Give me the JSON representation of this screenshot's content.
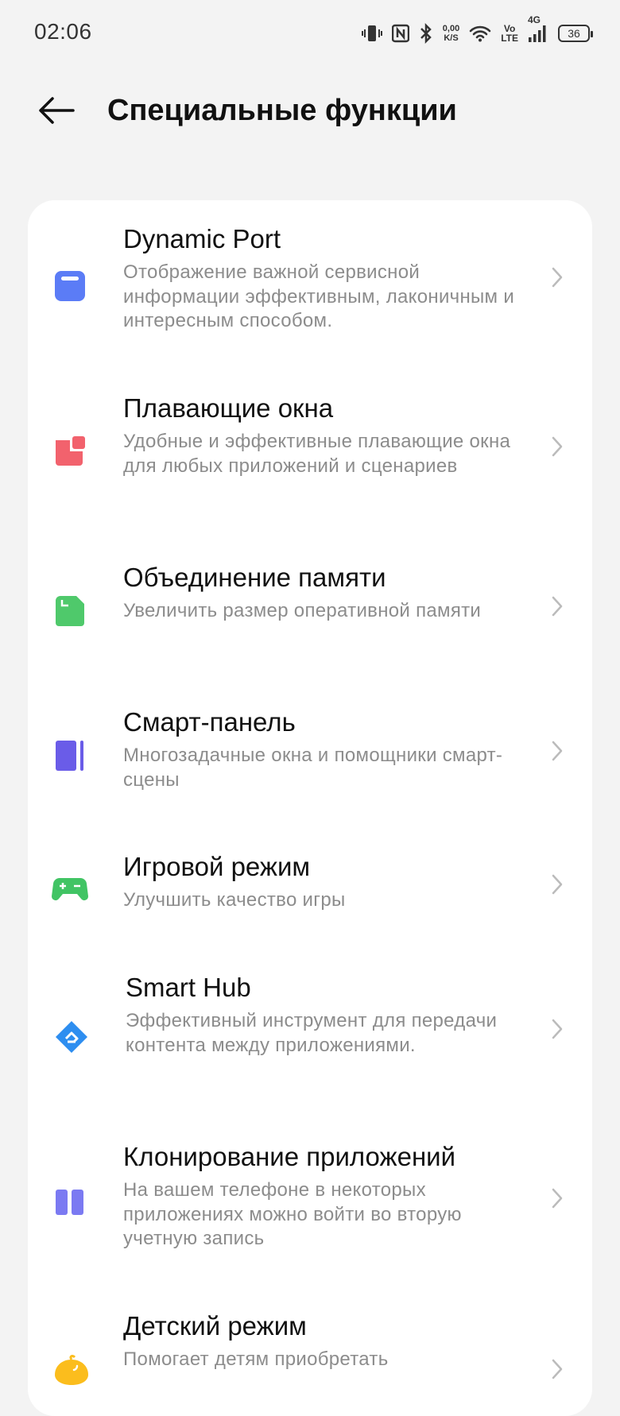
{
  "status_bar": {
    "time": "02:06",
    "net_speed_value": "0,00",
    "net_speed_unit": "K/S",
    "volte_top": "Vo",
    "volte_bottom": "LTE",
    "network_type": "4G",
    "battery": "36"
  },
  "header": {
    "title": "Специальные функции"
  },
  "items": [
    {
      "title": "Dynamic Port",
      "description": "Отображение важной сервисной информации эффективным, лаконичным и интересным способом.",
      "icon": "dynamic-port-icon",
      "color": "#5b7cf6"
    },
    {
      "title": "Плавающие окна",
      "description": "Удобные и эффективные плавающие окна для любых приложений и сценариев",
      "icon": "floating-windows-icon",
      "color": "#f2626d"
    },
    {
      "title": "Объединение памяти",
      "description": "Увеличить размер оперативной памяти",
      "icon": "memory-card-icon",
      "color": "#4fc96b"
    },
    {
      "title": "Смарт-панель",
      "description": "Многозадачные окна и помощники смарт-сцены",
      "icon": "smart-panel-icon",
      "color": "#6a5ce8"
    },
    {
      "title": "Игровой режим",
      "description": "Улучшить качество игры",
      "icon": "gamepad-icon",
      "color": "#41c464"
    },
    {
      "title": "Smart Hub",
      "description": "Эффективный инструмент для передачи контента между приложениями.",
      "icon": "smart-hub-icon",
      "color": "#2e8ef0"
    },
    {
      "title": "Клонирование приложений",
      "description": "На вашем телефоне в некоторых приложениях можно войти во вторую учетную запись",
      "icon": "app-clone-icon",
      "color": "#7b7af2"
    },
    {
      "title": "Детский режим",
      "description": "Помогает детям приобретать",
      "icon": "kids-mode-icon",
      "color": "#fbbd1d"
    }
  ]
}
